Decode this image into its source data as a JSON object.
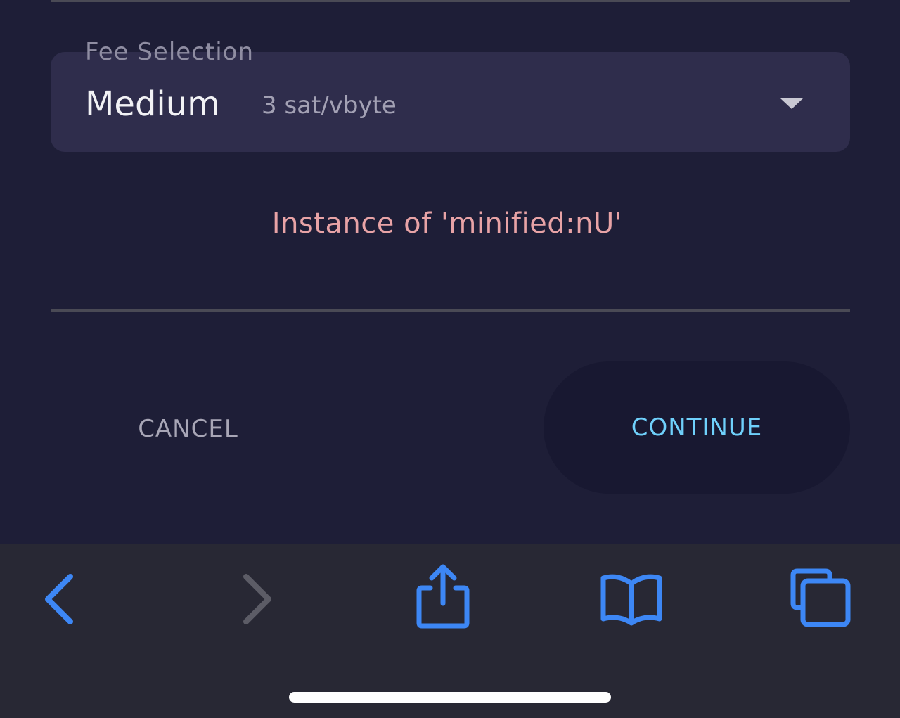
{
  "fee_selection": {
    "label": "Fee Selection",
    "level": "Medium",
    "rate": "3 sat/vbyte",
    "dropdown_icon": "caret-down-icon"
  },
  "error_message": "Instance of 'minified:nU'",
  "actions": {
    "cancel_label": "CANCEL",
    "continue_label": "CONTINUE"
  },
  "browser_toolbar": {
    "icons": [
      "back-icon",
      "forward-icon",
      "share-icon",
      "bookmarks-icon",
      "tabs-icon"
    ]
  },
  "colors": {
    "background": "#1e1e37",
    "accent": "#6fd0fb",
    "error": "#e8a3a6",
    "toolbar_icon": "#3d87f5"
  }
}
